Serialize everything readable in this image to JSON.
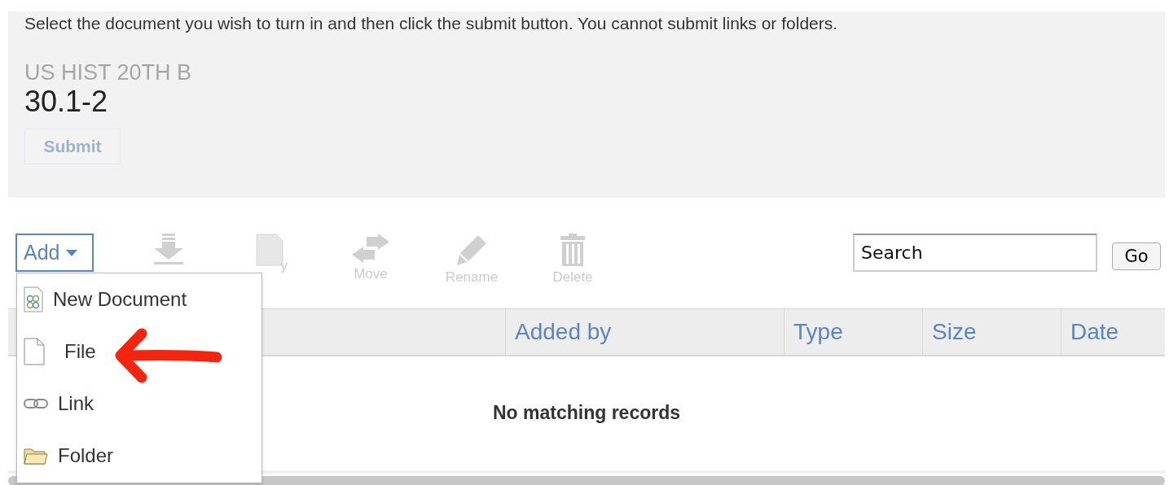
{
  "instructions": "Select the document you wish to turn in and then click the submit button. You cannot submit links or folders.",
  "course": "US HIST 20TH B",
  "assignment": "30.1-2",
  "submit": {
    "label": "Submit",
    "disabled": true
  },
  "add_button": {
    "label": "Add",
    "expanded": true
  },
  "toolbar": [
    {
      "kind": "download",
      "disabled": true
    },
    {
      "kind": "copy",
      "label": "y",
      "disabled": true
    },
    {
      "kind": "move",
      "label": "Move",
      "disabled": true
    },
    {
      "kind": "rename",
      "label": "Rename",
      "disabled": true
    },
    {
      "kind": "delete",
      "label": "Delete",
      "disabled": true
    }
  ],
  "search": {
    "placeholder": "Search"
  },
  "go_button": "Go",
  "table": {
    "columns": [
      "Added by",
      "Type",
      "Size",
      "Date"
    ],
    "empty_message": "No matching records"
  },
  "add_menu": [
    {
      "kind": "document",
      "label": "New Document"
    },
    {
      "kind": "file",
      "label": "File"
    },
    {
      "kind": "link",
      "label": "Link"
    },
    {
      "kind": "folder",
      "label": "Folder"
    }
  ]
}
